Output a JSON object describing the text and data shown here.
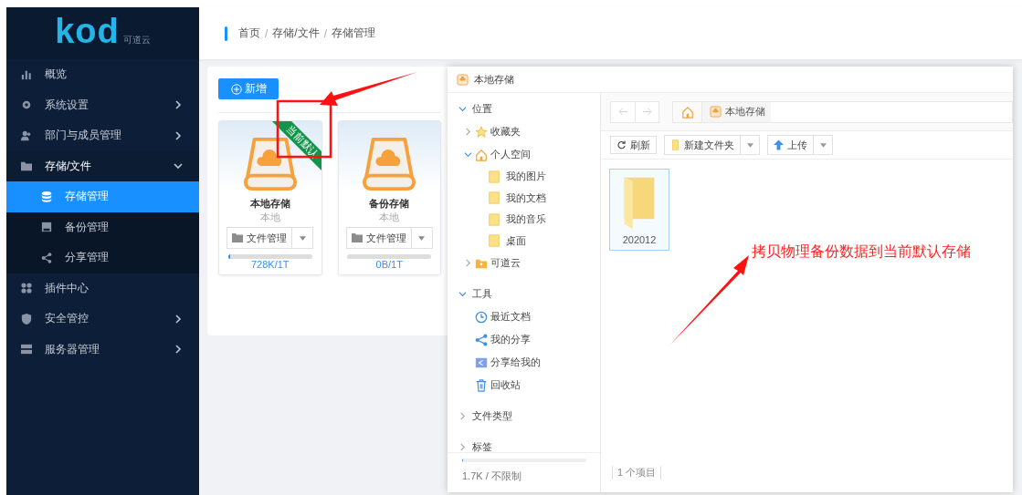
{
  "sidebar": {
    "logo": "kod",
    "logo_sub": "可道云",
    "items": [
      {
        "label": "概览",
        "kind": "link",
        "selected": false
      },
      {
        "label": "系统设置",
        "kind": "menu",
        "expanded": false,
        "selected": false
      },
      {
        "label": "部门与成员管理",
        "kind": "menu",
        "expanded": false,
        "selected": false
      },
      {
        "label": "存储/文件",
        "kind": "menu",
        "expanded": true,
        "selected": false,
        "children": [
          {
            "label": "存储管理",
            "selected": true
          },
          {
            "label": "备份管理",
            "selected": false
          },
          {
            "label": "分享管理",
            "selected": false
          }
        ]
      },
      {
        "label": "插件中心",
        "kind": "link",
        "selected": false
      },
      {
        "label": "安全管控",
        "kind": "menu",
        "expanded": false,
        "selected": false
      },
      {
        "label": "服务器管理",
        "kind": "menu",
        "expanded": false,
        "selected": false
      }
    ]
  },
  "breadcrumb": [
    {
      "label": "首页",
      "separator": "/"
    },
    {
      "label": "存储/文件",
      "separator": "/"
    },
    {
      "label": "存储管理"
    }
  ],
  "add_button": "新增",
  "storages": [
    {
      "name": "本地存储",
      "type": "本地",
      "badge": "当前默认",
      "manage_button": "文件管理",
      "level": 0.02,
      "usage": "728K/1T"
    },
    {
      "name": "备份存储",
      "type": "本地",
      "manage_button": "文件管理",
      "usage": "0B/1T"
    }
  ],
  "explorer": {
    "title": "本地存储",
    "tree": [
      {
        "label": "位置",
        "expanded": true,
        "children": [
          {
            "label": "收藏夹",
            "expanded": false
          },
          {
            "label": "个人空间",
            "expanded": true,
            "children": [
              {
                "label": "我的图片"
              },
              {
                "label": "我的文档"
              },
              {
                "label": "我的音乐"
              },
              {
                "label": "桌面"
              }
            ]
          },
          {
            "label": "可道云",
            "expanded": false
          }
        ]
      },
      {
        "label": "工具",
        "expanded": true,
        "children": [
          {
            "label": "最近文档"
          },
          {
            "label": "我的分享"
          },
          {
            "label": "分享给我的"
          },
          {
            "label": "回收站"
          }
        ]
      },
      {
        "label": "文件类型",
        "expanded": false
      },
      {
        "label": "标签",
        "expanded": false
      }
    ],
    "quota": {
      "text": "1.7K / 不限制",
      "level": 0.01
    },
    "path": "本地存储",
    "toolbar": {
      "refresh": "刷新",
      "new_folder": "新建文件夹",
      "upload": "上传"
    },
    "files": [
      {
        "name": "202012",
        "selected": true
      }
    ],
    "status": "1 个项目"
  },
  "annotation": "拷贝物理备份数据到当前默认存储"
}
